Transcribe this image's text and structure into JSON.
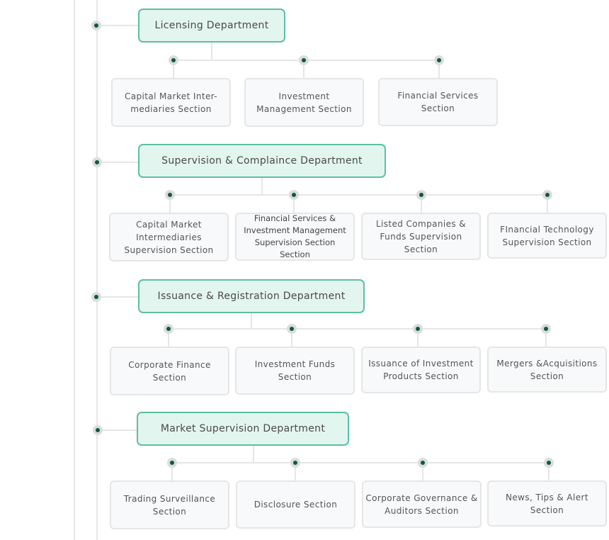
{
  "colors": {
    "department_border": "#5cbfa3",
    "department_fill": "#e3f5ef",
    "node_dot": "#0b5a45",
    "connector": "#e6e6e6"
  },
  "departments": [
    {
      "title": "Licensing Department",
      "sections": [
        "Capital Market Inter-mediaries Section",
        "Investment Management Section",
        "Financial Services Section"
      ]
    },
    {
      "title": "Supervision & Complaince Department",
      "sections": [
        "Capital Market Intermediaries Supervision Section",
        "Financial Services & Investment Management Supervision Section Section",
        "Listed Companies & Funds Supervision Section",
        "FInancial Technology Supervision Section"
      ]
    },
    {
      "title": "Issuance & Registration Department",
      "sections": [
        "Corporate Finance Section",
        "Investment Funds Section",
        "Issuance of Investment Products Section",
        "Mergers &Acquisitions Section"
      ]
    },
    {
      "title": "Market Supervision Department",
      "sections": [
        "Trading Surveillance Section",
        "Disclosure Section",
        "Corporate Governance & Auditors Section",
        "News, Tips & Alert Section"
      ]
    }
  ]
}
